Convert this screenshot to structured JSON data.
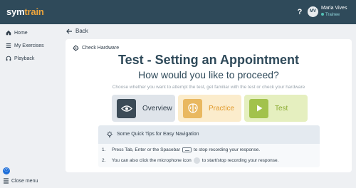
{
  "app": {
    "logo_main": "sym",
    "logo_accent": "train",
    "help_icon": "?",
    "user": {
      "initials": "MV",
      "name": "Maria Vives",
      "role": "Trainee"
    }
  },
  "sidebar": {
    "items": [
      {
        "label": "Home",
        "icon": "home-icon"
      },
      {
        "label": "My Exercises",
        "icon": "list-icon"
      },
      {
        "label": "Playback",
        "icon": "headphones-icon"
      }
    ],
    "close_menu": "Close menu"
  },
  "nav": {
    "back": "Back"
  },
  "card": {
    "check_hardware": "Check Hardware",
    "title": "Test - Setting an Appointment",
    "subtitle": "How would you like to proceed?",
    "hint": "Choose whether you want to attempt the test, get familiar with the test or check your hardware",
    "options": [
      {
        "label": "Overview",
        "icon": "eye-icon"
      },
      {
        "label": "Practice",
        "icon": "brain-icon"
      },
      {
        "label": "Test",
        "icon": "play-icon"
      }
    ]
  },
  "tips": {
    "title": "Some Quick Tips for Easy Navigation",
    "items": [
      {
        "num": "1.",
        "before": "Press Tab, Enter or the Spacebar",
        "after": "to stop recording your response."
      },
      {
        "num": "2.",
        "before": "You can also click the microphone icon",
        "after": "to start/stop recording your response."
      }
    ]
  },
  "colors": {
    "topbar": "#2f4a5a",
    "overview_bg": "#dfe4ea",
    "practice_bg": "#fbeccc",
    "test_bg": "#e5efbf",
    "accent_orange": "#f0a63c"
  }
}
